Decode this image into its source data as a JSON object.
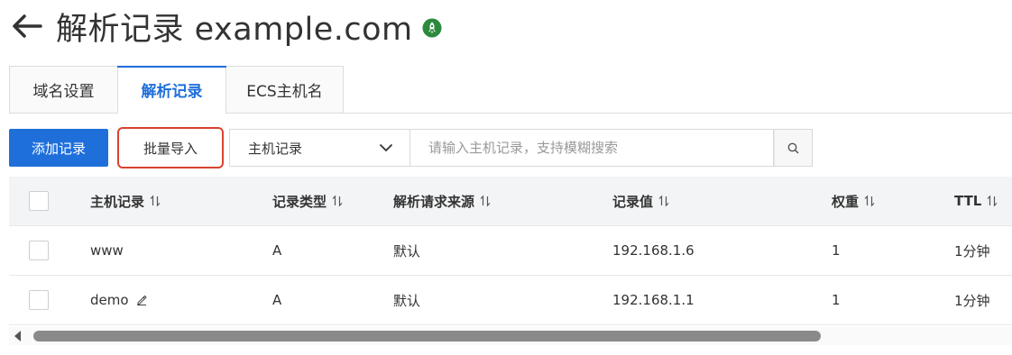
{
  "header": {
    "title": "解析记录 example.com"
  },
  "tabs": [
    {
      "label": "域名设置"
    },
    {
      "label": "解析记录"
    },
    {
      "label": "ECS主机名"
    }
  ],
  "toolbar": {
    "add_label": "添加记录",
    "import_label": "批量导入",
    "select_value": "主机记录",
    "search_placeholder": "请输入主机记录，支持模糊搜索"
  },
  "table": {
    "columns": [
      "主机记录",
      "记录类型",
      "解析请求来源",
      "记录值",
      "权重",
      "TTL"
    ],
    "rows": [
      {
        "host": "www",
        "type": "A",
        "line": "默认",
        "value": "192.168.1.6",
        "weight": "1",
        "ttl": "1分钟"
      },
      {
        "host": "demo",
        "type": "A",
        "line": "默认",
        "value": "192.168.1.1",
        "weight": "1",
        "ttl": "1分钟"
      }
    ]
  },
  "colors": {
    "primary": "#1f6fdb",
    "highlight": "#d9422f",
    "status": "#2c8a3e"
  },
  "icons": [
    "back-arrow-icon",
    "status-icon",
    "chevron-down-icon",
    "search-icon",
    "sort-icon",
    "edit-icon"
  ]
}
